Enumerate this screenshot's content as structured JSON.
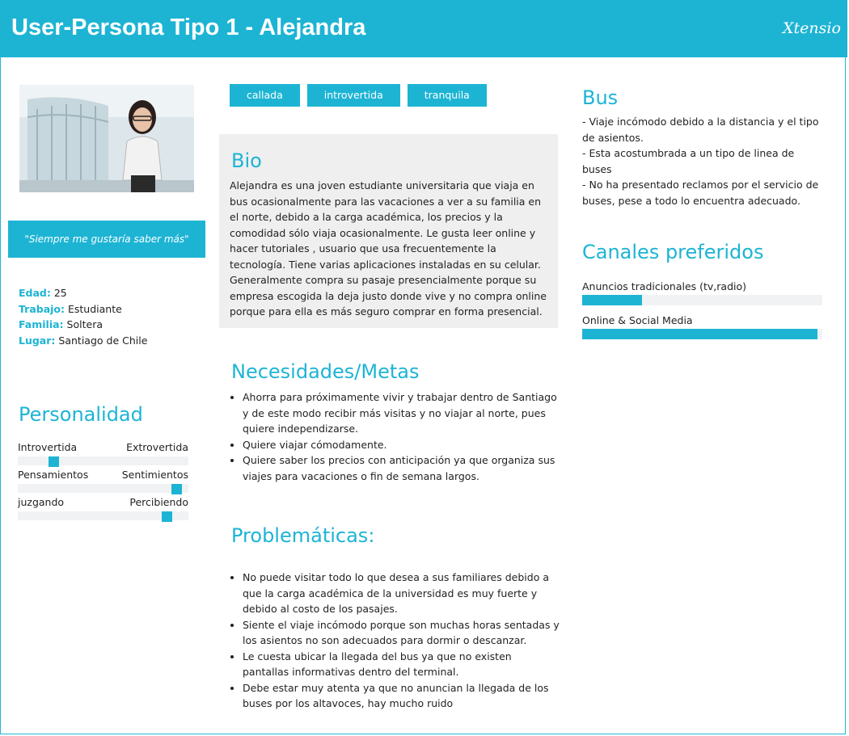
{
  "header": {
    "title": "User-Persona Tipo 1 - Alejandra",
    "brand": "Xtensio"
  },
  "quote": "\"Siempre me gustaría saber más\"",
  "info": [
    {
      "key": "Edad:",
      "value": "25"
    },
    {
      "key": "Trabajo:",
      "value": "Estudiante"
    },
    {
      "key": "Familia:",
      "value": "Soltera"
    },
    {
      "key": "Lugar:",
      "value": "Santiago de Chile"
    }
  ],
  "personality": {
    "title": "Personalidad",
    "sliders": [
      {
        "left": "Introvertida",
        "right": "Extrovertida",
        "level": 0.19
      },
      {
        "left": "Pensamientos",
        "right": "Sentimientos",
        "level": 0.96
      },
      {
        "left": "juzgando",
        "right": "Percibiendo",
        "level": 0.9
      }
    ]
  },
  "tags": [
    "callada",
    "introvertida",
    "tranquila"
  ],
  "bio": {
    "title": "Bio",
    "text": "Alejandra es una joven estudiante universitaria que viaja en bus ocasionalmente para las vacaciones a ver a su familia en el norte, debido a la carga académica, los precios y la comodidad sólo viaja ocasionalmente. Le gusta leer online y hacer tutoriales , usuario que usa frecuentemente la tecnología. Tiene varias aplicaciones instaladas en su celular. Generalmente compra su pasaje presencialmente porque su empresa escogida la deja justo donde vive y no compra online porque para ella es más seguro comprar en forma presencial."
  },
  "needs": {
    "title": "Necesidades/Metas",
    "items": [
      "Ahorra para próximamente vivir y trabajar dentro de Santiago y de este modo recibir más visitas y no viajar al norte, pues quiere independizarse.",
      "Quiere viajar cómodamente.",
      "Quiere saber los precios con anticipación ya que organiza sus viajes para vacaciones o fin de semana largos."
    ]
  },
  "problems": {
    "title": "Problemáticas:",
    "items": [
      "No puede visitar todo lo que desea a sus familiares debido a que la carga académica de la universidad es muy fuerte y debido al costo de los pasajes.",
      "Siente el viaje incómodo porque son muchas horas sentadas y los asientos no son adecuados para dormir o descanzar.",
      "Le cuesta ubicar la llegada del bus ya que no existen pantallas informativas dentro del terminal.",
      "Debe estar muy atenta ya que no anuncian la llegada de los buses por los altavoces, hay mucho ruido"
    ]
  },
  "bus": {
    "title": "Bus",
    "lines": [
      "- Viaje incómodo debido a la distancia y el tipo de asientos.",
      "- Esta acostumbrada a un tipo de linea de buses",
      "- No ha presentado reclamos por el servicio de buses, pese a todo lo encuentra adecuado."
    ]
  },
  "channels": {
    "title": "Canales preferidos",
    "items": [
      {
        "label": "Anuncios tradicionales (tv,radio)",
        "level": 0.25
      },
      {
        "label": "Online & Social Media",
        "level": 0.98
      }
    ]
  },
  "colors": {
    "accent": "#1db4d4",
    "panel": "#efefef",
    "track": "#f0f2f4"
  }
}
